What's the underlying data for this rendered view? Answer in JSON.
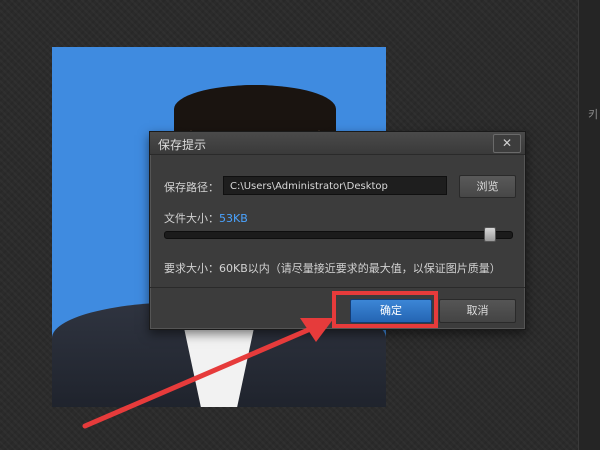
{
  "dialog": {
    "title": "保存提示",
    "close_glyph": "✕",
    "path_label": "保存路径：",
    "path_value": "C:\\Users\\Administrator\\Desktop",
    "browse_label": "浏览",
    "size_label": "文件大小：",
    "size_value": "53KB",
    "size_slider_fraction": 0.95,
    "requirement_text": "要求大小：60KB以内（请尽量接近要求的最大值，以保证图片质量）",
    "ok_label": "确定",
    "cancel_label": "取消"
  },
  "side_strip": {
    "char": "키"
  },
  "colors": {
    "photo_background": "#3f8be0",
    "accent_blue": "#4aa3ff",
    "annotation_red": "#e63b3b",
    "dialog_bg": "#3c3c3c"
  }
}
